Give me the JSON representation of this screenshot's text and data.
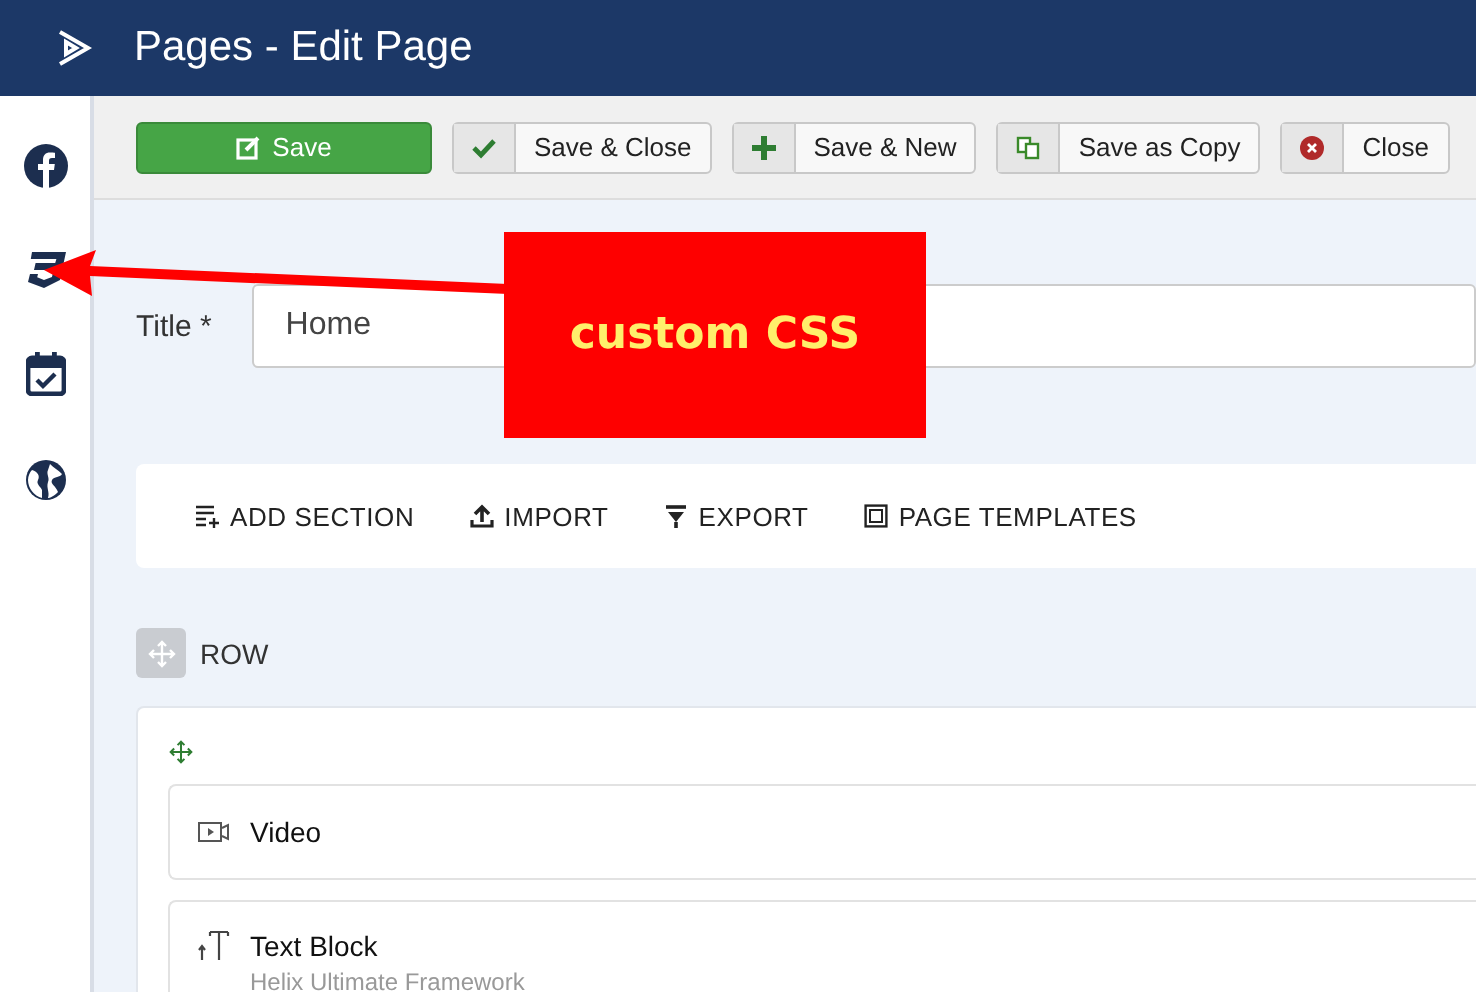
{
  "header": {
    "title": "Pages - Edit Page"
  },
  "toolbar": [
    {
      "kind": "save",
      "label": "Save"
    },
    {
      "kind": "check",
      "label": "Save & Close"
    },
    {
      "kind": "plus",
      "label": "Save & New"
    },
    {
      "kind": "copy",
      "label": "Save as Copy"
    },
    {
      "kind": "close",
      "label": "Close"
    }
  ],
  "title_field": {
    "label": "Title *",
    "value": "Home"
  },
  "builder_actions": [
    {
      "kind": "add",
      "label": "ADD SECTION"
    },
    {
      "kind": "import",
      "label": "IMPORT"
    },
    {
      "kind": "export",
      "label": "EXPORT"
    },
    {
      "kind": "templates",
      "label": "PAGE TEMPLATES"
    }
  ],
  "row": {
    "label": "ROW",
    "addons": [
      {
        "kind": "video",
        "title": "Video"
      },
      {
        "kind": "text",
        "title": "Text Block",
        "subtitle": "Helix Ultimate Framework"
      }
    ]
  },
  "annotation": {
    "text": "custom CSS"
  }
}
